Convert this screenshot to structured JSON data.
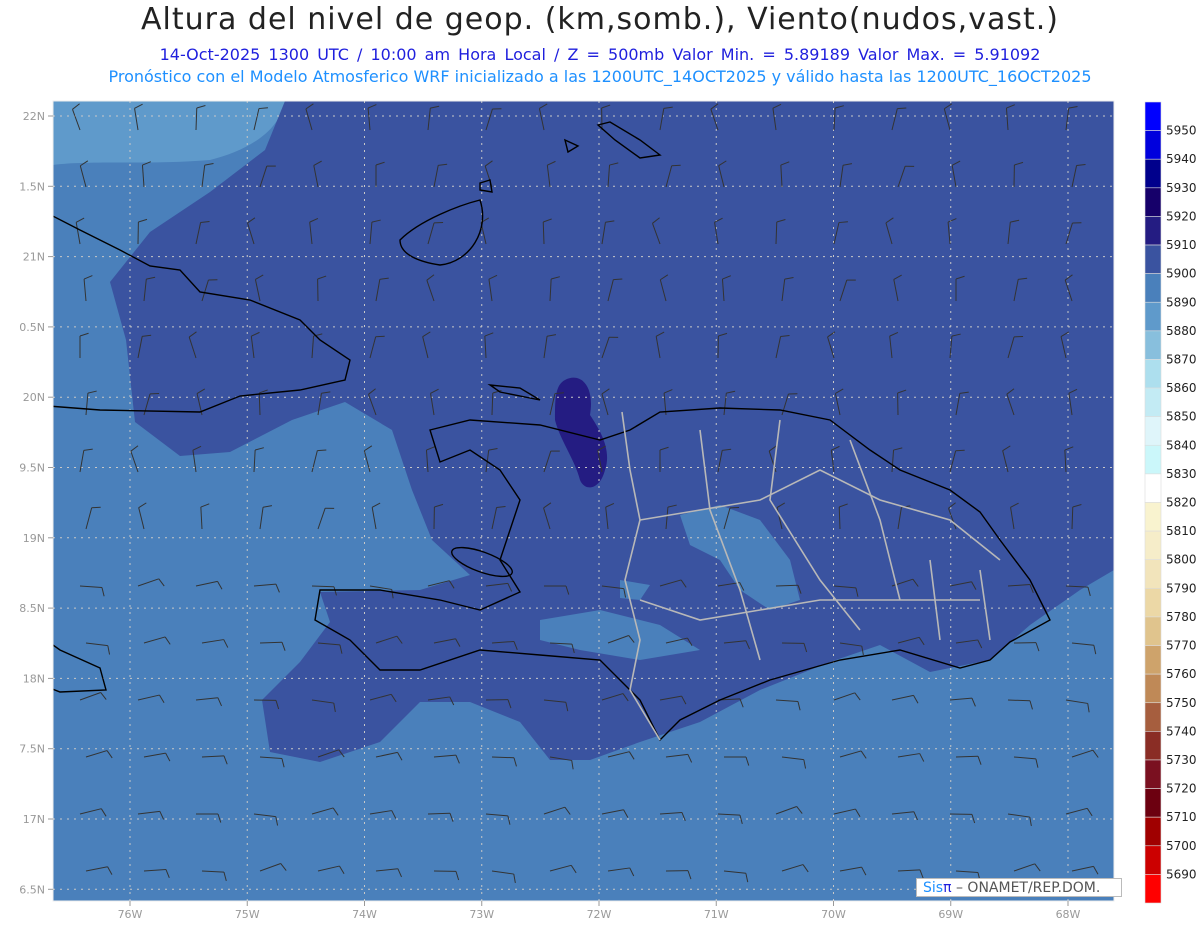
{
  "title": "Altura del nivel de geop. (km,somb.), Viento(nudos,vast.)",
  "subtitle": "14-Oct-2025  1300 UTC / 10:00 am Hora Local / Z = 500mb   Valor Min. = 5.89189  Valor Max. = 5.91092",
  "info": "Pronóstico con el Modelo Atmosferico WRF inicializado a las 1200UTC_14OCT2025 y válido hasta las  1200UTC_16OCT2025",
  "lon_labels": [
    "76W",
    "75W",
    "74W",
    "73W",
    "72W",
    "71W",
    "70W",
    "69W",
    "68W"
  ],
  "lat_labels": [
    "22N",
    "1.5N",
    "21N",
    "0.5N",
    "20N",
    "9.5N",
    "19N",
    "8.5N",
    "18N",
    "7.5N",
    "17N",
    "6.5N"
  ],
  "colorbar": {
    "labels": [
      "5950",
      "5940",
      "5930",
      "5920",
      "5910",
      "5900",
      "5890",
      "5880",
      "5870",
      "5860",
      "5850",
      "5840",
      "5830",
      "5820",
      "5810",
      "5800",
      "5790",
      "5780",
      "5770",
      "5760",
      "5750",
      "5740",
      "5730",
      "5720",
      "5710",
      "5700",
      "5690"
    ],
    "colors": [
      "#0000ff",
      "#0000dd",
      "#00008c",
      "#16006a",
      "#241c82",
      "#3a53a0",
      "#4a80bb",
      "#5f9acb",
      "#88bfdd",
      "#addfee",
      "#c3ebf4",
      "#dff5fa",
      "#cbf7fa",
      "#ffffff",
      "#f9f3cf",
      "#f6edc9",
      "#f2e4bb",
      "#ecd8a6",
      "#e0c48d",
      "#cea36b",
      "#bf8957",
      "#a65e3e",
      "#8a2d25",
      "#7a1020",
      "#6c0010",
      "#a00000",
      "#cc0000",
      "#ff0000"
    ]
  },
  "field_colors": {
    "base": "#4a80bb",
    "high": "#3a53a0",
    "max": "#241c82",
    "low": "#5f9acb"
  },
  "credit": {
    "brand_a": "Sis",
    "brand_b": "π",
    "text": "– ONAMET/REP.DOM."
  }
}
